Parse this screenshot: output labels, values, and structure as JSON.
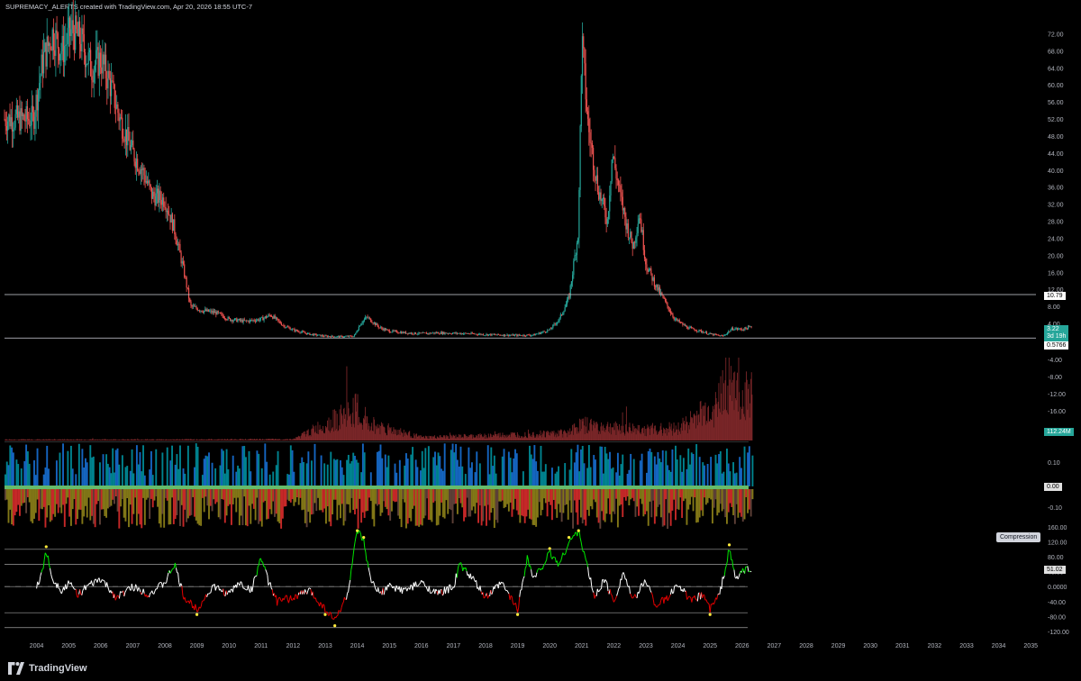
{
  "header": {
    "title": "SUPREMACY_ALERTS created with TradingView.com, Apr 20, 2026 18:55 UTC-7"
  },
  "footer": {
    "brand": "TradingView"
  },
  "price_tags": {
    "upper_line": "10.79",
    "last_price": "3.22",
    "countdown": "3d 19h",
    "lower_line": "0.5766",
    "volume": "112.24M",
    "osc1_value": "0.00",
    "osc2_value": "51.02",
    "osc2_label": "Compression"
  },
  "colors": {
    "up": "#26a69a",
    "down": "#ef5350",
    "volume": "#7a2628",
    "bar_blue": "#1565c0",
    "bar_teal": "#00838f",
    "bar_olive": "#827717",
    "bar_red": "#c62828",
    "osc_green": "#00e600",
    "osc_red": "#e00000",
    "osc_white": "#ffffff",
    "dot_yellow": "#ffeb3b"
  },
  "chart_data": [
    {
      "type": "line",
      "style": "candlestick",
      "pane": "price",
      "x_axis_years": [
        "2004",
        "2005",
        "2006",
        "2007",
        "2008",
        "2009",
        "2010",
        "2011",
        "2012",
        "2013",
        "2014",
        "2015",
        "2016",
        "2017",
        "2018",
        "2019",
        "2020",
        "2021",
        "2022",
        "2023",
        "2024",
        "2025",
        "2026",
        "2027",
        "2028",
        "2029",
        "2030",
        "2031",
        "2032",
        "2033",
        "2034",
        "2035"
      ],
      "y_ticks": [
        "72.00",
        "68.00",
        "64.00",
        "60.00",
        "56.00",
        "52.00",
        "48.00",
        "44.00",
        "40.00",
        "36.00",
        "32.00",
        "28.00",
        "24.00",
        "20.00",
        "16.00",
        "12.00",
        "8.00",
        "4.00"
      ],
      "ylim": [
        0,
        74
      ],
      "horizontal_lines": [
        10.79,
        0.5766
      ],
      "series": [
        {
          "x": [
            2003.9,
            2004.2,
            2004.5,
            2004.8,
            2005.1,
            2005.4,
            2005.7,
            2006.0,
            2006.3,
            2006.6,
            2007.0,
            2007.3,
            2007.6,
            2008.0,
            2008.3,
            2008.6,
            2008.8,
            2009.2,
            2009.6,
            2010.0,
            2010.5,
            2011.0,
            2011.3,
            2011.7,
            2012.0,
            2012.5,
            2013.0,
            2013.5,
            2013.9,
            2014.1,
            2014.3,
            2014.7,
            2015.0,
            2015.5,
            2016.0,
            2016.5,
            2017.0,
            2017.5,
            2018.0,
            2018.5,
            2019.0,
            2019.5,
            2020.0,
            2020.3,
            2020.6,
            2020.9,
            2021.0,
            2021.2,
            2021.5,
            2021.8,
            2021.95,
            2022.2,
            2022.4,
            2022.6,
            2022.8,
            2023.0,
            2023.3,
            2023.6,
            2023.9,
            2024.3,
            2024.7,
            2025.0,
            2025.4,
            2025.7,
            2026.0,
            2026.3
          ],
          "y": [
            52,
            66,
            72,
            68,
            73,
            70,
            64,
            66,
            60,
            52,
            44,
            40,
            34,
            33,
            26,
            16,
            8,
            7,
            6.5,
            5,
            4.5,
            5,
            6,
            3.5,
            2.5,
            1.5,
            1.0,
            0.9,
            1.0,
            4,
            5.5,
            3,
            2.2,
            1.8,
            1.6,
            1.8,
            1.7,
            1.6,
            1.4,
            1.3,
            1.2,
            1.3,
            2.5,
            5,
            10,
            26,
            71,
            50,
            36,
            28,
            44,
            34,
            27,
            22,
            30,
            18,
            13,
            9,
            5,
            3,
            2.2,
            1.5,
            1.0,
            2.8,
            2.6,
            3.22
          ]
        }
      ]
    },
    {
      "type": "bar",
      "pane": "volume",
      "y_ticks": [
        "-4.00",
        "-8.00",
        "-12.00",
        "-16.00"
      ],
      "series": [
        {
          "x": [
            2004,
            2008,
            2012,
            2014.0,
            2014.1,
            2016,
            2018,
            2020.5,
            2021.0,
            2022,
            2023,
            2024,
            2024.8,
            2025.2,
            2025.5,
            2025.7,
            2025.9,
            2026.2
          ],
          "values": [
            0.3,
            0.3,
            0.4,
            10,
            6,
            1,
            1.5,
            2.5,
            5,
            4,
            3.5,
            4,
            9,
            11,
            20,
            20,
            12,
            15
          ]
        }
      ]
    },
    {
      "type": "area",
      "pane": "oscillator-1",
      "y_ticks": [
        "0.10",
        "0.00",
        "-0.10"
      ],
      "ylim": [
        -0.14,
        0.14
      ]
    },
    {
      "type": "line",
      "pane": "oscillator-2",
      "y_ticks": [
        "160.00",
        "120.00",
        "80.00",
        "40.00",
        "0.0000",
        "-40.00",
        "-80.00",
        "-120.00"
      ],
      "ylim": [
        -130,
        160
      ],
      "levels": [
        100,
        60,
        0,
        -70,
        -110
      ],
      "series": [
        {
          "x": [
            2004.0,
            2004.1,
            2004.3,
            2004.5,
            2004.8,
            2005.0,
            2005.3,
            2005.6,
            2006.0,
            2006.5,
            2007.0,
            2007.5,
            2008.0,
            2008.3,
            2008.6,
            2009.0,
            2009.5,
            2010.0,
            2010.3,
            2010.7,
            2011.0,
            2011.2,
            2011.5,
            2012.0,
            2012.5,
            2013.0,
            2013.3,
            2013.7,
            2014.0,
            2014.2,
            2014.4,
            2014.7,
            2015.0,
            2015.5,
            2016.0,
            2016.5,
            2017.0,
            2017.2,
            2017.6,
            2018.0,
            2018.5,
            2019.0,
            2019.3,
            2019.5,
            2019.8,
            2020.0,
            2020.3,
            2020.6,
            2020.9,
            2021.1,
            2021.4,
            2021.7,
            2022.0,
            2022.3,
            2022.6,
            2023.0,
            2023.3,
            2023.7,
            2024.0,
            2024.4,
            2024.8,
            2025.0,
            2025.3,
            2025.6,
            2025.8,
            2026.0,
            2026.3
          ],
          "values": [
            0,
            15,
            95,
            20,
            -10,
            10,
            -20,
            0,
            20,
            -30,
            0,
            -20,
            10,
            60,
            -30,
            -60,
            0,
            -20,
            10,
            -10,
            80,
            20,
            -40,
            -30,
            -10,
            -60,
            -90,
            -20,
            150,
            120,
            20,
            -20,
            0,
            -10,
            10,
            -20,
            0,
            60,
            20,
            -30,
            10,
            -60,
            80,
            20,
            60,
            90,
            60,
            120,
            150,
            80,
            -30,
            20,
            -40,
            40,
            -40,
            20,
            -50,
            -30,
            10,
            -40,
            -20,
            -60,
            -20,
            100,
            20,
            40,
            51.02
          ]
        }
      ]
    }
  ]
}
